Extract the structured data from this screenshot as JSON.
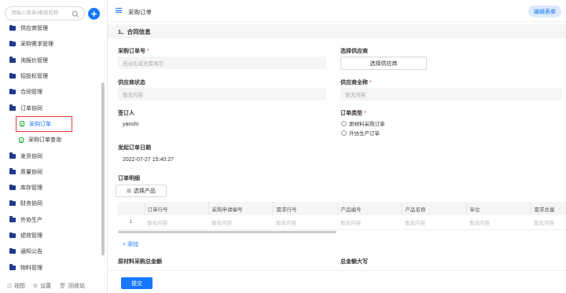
{
  "sidebar": {
    "search_placeholder": "请输入表单/报表名称",
    "items": [
      {
        "label": "供应商管理",
        "type": "folder"
      },
      {
        "label": "采购需求管理",
        "type": "folder"
      },
      {
        "label": "询报价管理",
        "type": "folder"
      },
      {
        "label": "招投标管理",
        "type": "folder"
      },
      {
        "label": "合同管理",
        "type": "folder"
      },
      {
        "label": "订单协同",
        "type": "folder"
      },
      {
        "label": "采购订单",
        "type": "doc",
        "active": true
      },
      {
        "label": "采购订单查询",
        "type": "doc"
      },
      {
        "label": "发货协同",
        "type": "folder"
      },
      {
        "label": "质量协同",
        "type": "folder"
      },
      {
        "label": "库存管理",
        "type": "folder"
      },
      {
        "label": "财务协同",
        "type": "folder"
      },
      {
        "label": "外协生产",
        "type": "folder"
      },
      {
        "label": "绩效管理",
        "type": "folder"
      },
      {
        "label": "通知公告",
        "type": "folder"
      },
      {
        "label": "物料管理",
        "type": "folder"
      }
    ],
    "footer": {
      "view_label": "视图",
      "settings_label": "设置",
      "recycle_label": "回收站"
    }
  },
  "header": {
    "title": "采购订单",
    "edit_button": "编辑表单"
  },
  "form": {
    "section_title": "1、合同信息",
    "order_no": {
      "label": "采购订单号",
      "placeholder": "自动生成无需填写"
    },
    "select_supplier": {
      "label": "选择供应商",
      "button": "选择供应商"
    },
    "supplier_status": {
      "label": "供应商状态",
      "placeholder": "暂无内容"
    },
    "supplier_fullname": {
      "label": "供应商全称",
      "placeholder": "暂无内容"
    },
    "signer": {
      "label": "签订人",
      "value": "yanshi"
    },
    "order_type": {
      "label": "订单类型",
      "options": [
        "原材料采购订单",
        "外协生产订单"
      ]
    },
    "order_date": {
      "label": "发起订单日期",
      "value": "2022-07-27 15:40:27"
    },
    "order_detail": {
      "label": "订单明细",
      "select_product_button": "选择产品",
      "columns": [
        "",
        "订单行号",
        "采购申请编号",
        "需求行号",
        "产品编号",
        "产品名称",
        "单位",
        "需求总量"
      ],
      "rows": [
        [
          "1",
          "暂无内容",
          "暂无内容",
          "暂无内容",
          "暂无内容",
          "暂无内容",
          "暂无内容",
          "暂无内容"
        ]
      ],
      "add_link": "+ 添加"
    },
    "raw_total": {
      "label": "原材料采购总金额"
    },
    "total_caps": {
      "label": "总金额大写"
    }
  },
  "footer": {
    "submit": "提交"
  },
  "colors": {
    "accent": "#1677ff",
    "required": "#e53935",
    "folder": "#1f3a8a",
    "doc": "#2bb24c"
  }
}
